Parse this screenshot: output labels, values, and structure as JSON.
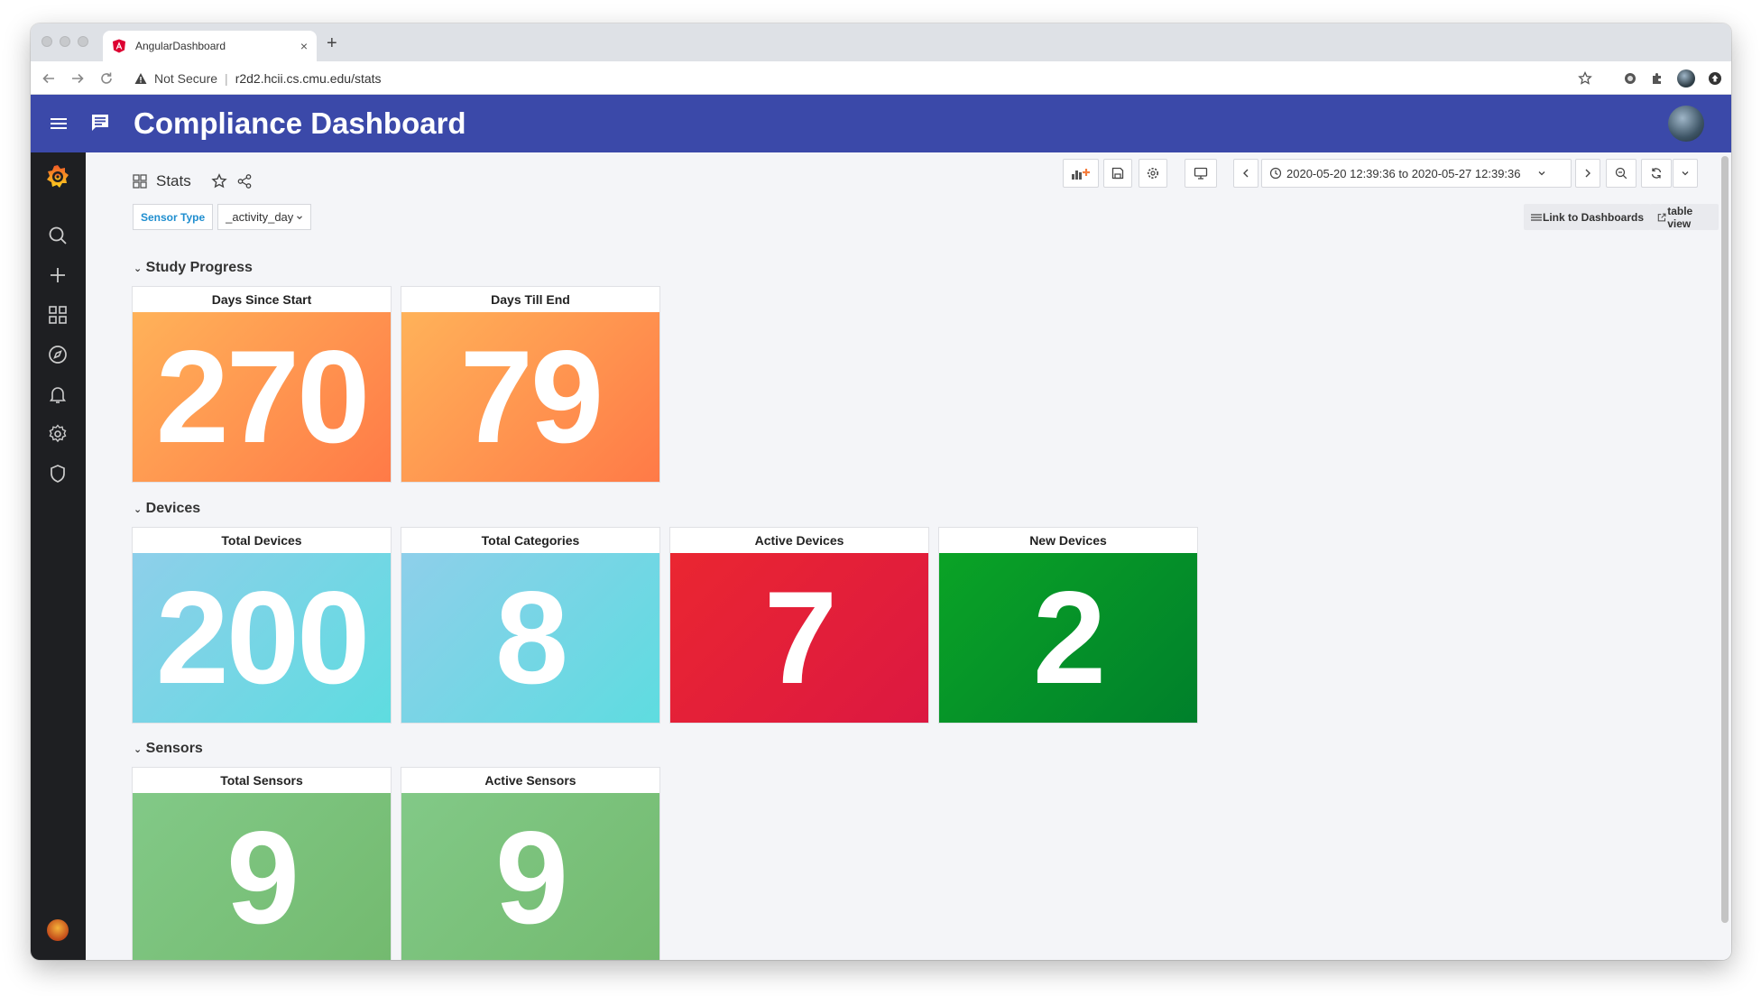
{
  "browser": {
    "tab_title": "AngularDashboard",
    "tab_close": "×",
    "new_tab": "+",
    "security_label": "Not Secure",
    "url": "r2d2.hcii.cs.cmu.edu/stats"
  },
  "app": {
    "title": "Compliance Dashboard"
  },
  "page": {
    "title": "Stats",
    "time_range": "2020-05-20 12:39:36 to 2020-05-27 12:39:36"
  },
  "variables": {
    "label": "Sensor Type",
    "value": "_activity_day"
  },
  "links": {
    "dashboards": "Link to Dashboards",
    "table_view": "table view"
  },
  "rows": [
    {
      "title": "Study Progress",
      "panels": [
        {
          "title": "Days Since Start",
          "value": "270"
        },
        {
          "title": "Days Till End",
          "value": "79"
        }
      ]
    },
    {
      "title": "Devices",
      "panels": [
        {
          "title": "Total Devices",
          "value": "200"
        },
        {
          "title": "Total Categories",
          "value": "8"
        },
        {
          "title": "Active Devices",
          "value": "7"
        },
        {
          "title": "New Devices",
          "value": "2"
        }
      ]
    },
    {
      "title": "Sensors",
      "panels": [
        {
          "title": "Total Sensors",
          "value": "9"
        },
        {
          "title": "Active Sensors",
          "value": "9"
        }
      ]
    }
  ],
  "colors": {
    "app_bar": "#3b49a9",
    "sidebar": "#1e1f22",
    "orange": "#ff8c4e",
    "blue": "#74d5e4",
    "red": "#e2203a",
    "green": "#01922a",
    "light_green": "#7bc27c"
  }
}
